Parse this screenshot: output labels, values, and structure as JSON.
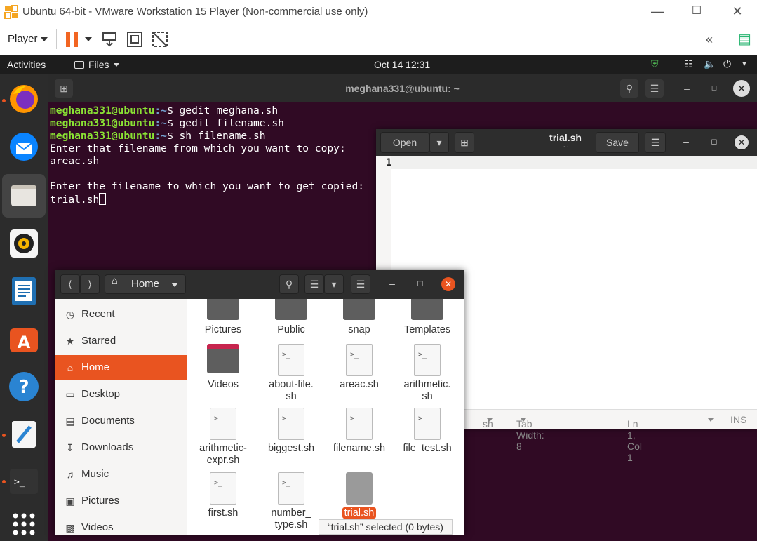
{
  "vmware": {
    "title": "Ubuntu 64-bit - VMware Workstation 15 Player (Non-commercial use only)",
    "player_label": "Player"
  },
  "topbar": {
    "activities": "Activities",
    "app_menu": "Files",
    "clock": "Oct 14  12:31"
  },
  "terminal": {
    "title": "meghana331@ubuntu: ~",
    "lines": [
      {
        "user": "meghana331@ubuntu",
        "path": ":~",
        "cmd": "$ gedit meghana.sh"
      },
      {
        "user": "meghana331@ubuntu",
        "path": ":~",
        "cmd": "$ gedit filename.sh"
      },
      {
        "user": "meghana331@ubuntu",
        "path": ":~",
        "cmd": "$ sh filename.sh"
      }
    ],
    "out1": "Enter that filename from which you want to copy:",
    "out2": "areac.sh",
    "out3": "Enter the filename to which you want to get copied:",
    "out4": "trial.sh"
  },
  "gedit": {
    "open_label": "Open",
    "save_label": "Save",
    "title": "trial.sh",
    "subtitle": "~",
    "line_number": "1",
    "status": {
      "lang": "sh",
      "tab": "Tab Width: 8",
      "pos": "Ln 1, Col 1",
      "mode": "INS"
    }
  },
  "files": {
    "path": "Home",
    "sidebar": [
      {
        "label": "Recent",
        "icon": "clock-icon"
      },
      {
        "label": "Starred",
        "icon": "star-icon"
      },
      {
        "label": "Home",
        "icon": "home-icon"
      },
      {
        "label": "Desktop",
        "icon": "desktop-icon"
      },
      {
        "label": "Documents",
        "icon": "document-icon"
      },
      {
        "label": "Downloads",
        "icon": "download-icon"
      },
      {
        "label": "Music",
        "icon": "music-icon"
      },
      {
        "label": "Pictures",
        "icon": "picture-icon"
      },
      {
        "label": "Videos",
        "icon": "video-icon"
      }
    ],
    "items": [
      {
        "name": "Pictures",
        "type": "folder"
      },
      {
        "name": "Public",
        "type": "folder"
      },
      {
        "name": "snap",
        "type": "folder"
      },
      {
        "name": "Templates",
        "type": "folder"
      },
      {
        "name": "Videos",
        "type": "folder"
      },
      {
        "name": "about-file.",
        "name2": "sh",
        "type": "script"
      },
      {
        "name": "areac.sh",
        "type": "script"
      },
      {
        "name": "arithmetic.",
        "name2": "sh",
        "type": "script"
      },
      {
        "name": "arithmetic-",
        "name2": "expr.sh",
        "type": "script"
      },
      {
        "name": "biggest.sh",
        "type": "script"
      },
      {
        "name": "filename.sh",
        "type": "script"
      },
      {
        "name": "file_test.sh",
        "type": "script"
      },
      {
        "name": "first.sh",
        "type": "script"
      },
      {
        "name": "number_",
        "name2": "type.sh",
        "type": "script"
      },
      {
        "name": "trial.sh",
        "type": "text",
        "selected": true
      }
    ],
    "selection_status": "“trial.sh” selected  (0 bytes)"
  },
  "colors": {
    "accent": "#e95420",
    "terminal_bg": "#300a24",
    "prompt_user": "#8ae234",
    "prompt_path": "#729fcf"
  }
}
